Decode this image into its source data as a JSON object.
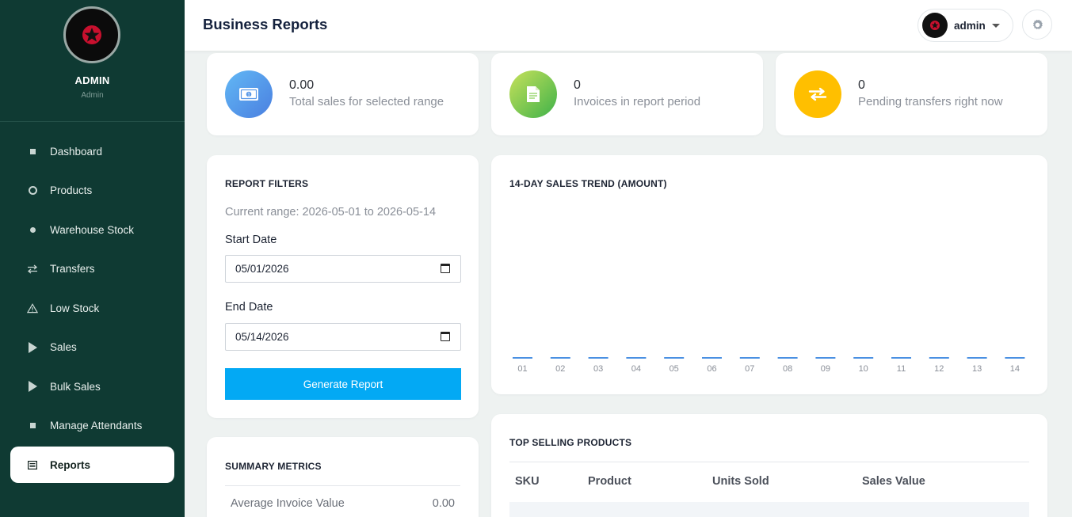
{
  "app": {
    "title": "Business Reports"
  },
  "profile": {
    "name": "ADMIN",
    "role": "Admin"
  },
  "sidebar": {
    "items": [
      {
        "label": "Dashboard",
        "icon": "square-icon"
      },
      {
        "label": "Products",
        "icon": "ring-icon"
      },
      {
        "label": "Warehouse Stock",
        "icon": "dot-icon"
      },
      {
        "label": "Transfers",
        "icon": "transfer-arrows-icon"
      },
      {
        "label": "Low Stock",
        "icon": "warning-icon"
      },
      {
        "label": "Sales",
        "icon": "play-icon"
      },
      {
        "label": "Bulk Sales",
        "icon": "play-icon"
      },
      {
        "label": "Manage Attendants",
        "icon": "square-icon"
      },
      {
        "label": "Reports",
        "icon": "report-list-icon",
        "active": true
      }
    ]
  },
  "header": {
    "user": "admin"
  },
  "stats": [
    {
      "value": "0.00",
      "label": "Total sales for selected range",
      "icon": "money-icon",
      "color": "#4a90e2"
    },
    {
      "value": "0",
      "label": "Invoices in report period",
      "icon": "document-icon",
      "color": "#7ac943"
    },
    {
      "value": "0",
      "label": "Pending transfers right now",
      "icon": "transfer-arrows-icon",
      "color": "#ffbf00"
    }
  ],
  "filters": {
    "title": "REPORT FILTERS",
    "range_text": "Current range: 2026-05-01 to 2026-05-14",
    "start_label": "Start Date",
    "start_value": "05/01/2026",
    "end_label": "End Date",
    "end_value": "05/14/2026",
    "button": "Generate Report"
  },
  "trend": {
    "title": "14-DAY SALES TREND (AMOUNT)"
  },
  "chart_data": {
    "type": "bar",
    "title": "14-DAY SALES TREND (AMOUNT)",
    "categories": [
      "01",
      "02",
      "03",
      "04",
      "05",
      "06",
      "07",
      "08",
      "09",
      "10",
      "11",
      "12",
      "13",
      "14"
    ],
    "values": [
      0,
      0,
      0,
      0,
      0,
      0,
      0,
      0,
      0,
      0,
      0,
      0,
      0,
      0
    ],
    "color": "#4a90e2"
  },
  "top_selling": {
    "title": "TOP SELLING PRODUCTS",
    "columns": [
      "SKU",
      "Product",
      "Units Sold",
      "Sales Value"
    ]
  },
  "summary": {
    "title": "SUMMARY METRICS",
    "rows": [
      {
        "label": "Average Invoice Value",
        "value": "0.00"
      }
    ]
  },
  "colors": {
    "sidebar": "#0f3a33",
    "accent": "#03a9f4"
  }
}
